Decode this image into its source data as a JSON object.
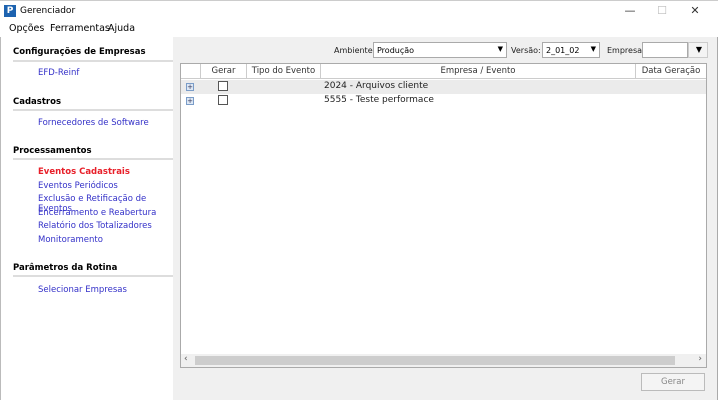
{
  "window": {
    "title": "Gerenciador",
    "minimize": "—",
    "maximize": "☐",
    "close": "✕"
  },
  "menu": [
    "Opções",
    "Ferramentas",
    "Ajuda"
  ],
  "sidebar": {
    "sections": [
      {
        "title": "Configurações de Empresas",
        "items": [
          "EFD-Reinf"
        ]
      },
      {
        "title": "Cadastros",
        "items": [
          "Fornecedores de Software"
        ]
      },
      {
        "title": "Processamentos",
        "items": [
          "Eventos Cadastrais",
          "Eventos Periódicos",
          "Exclusão e Retificação de Eventos",
          "Encerramento e Reabertura",
          "Relatório dos Totalizadores",
          "Monitoramento"
        ]
      },
      {
        "title": "Parâmetros da Rotina",
        "items": [
          "Selecionar Empresas"
        ]
      }
    ],
    "active": "Eventos Cadastrais"
  },
  "toolbar": {
    "ambiente_label": "Ambiente:",
    "ambiente_value": "Produção",
    "versao_label": "Versão:",
    "versao_value": "2_01_02",
    "empresa_label": "Empresa:",
    "empresa_value": ""
  },
  "grid": {
    "columns": [
      "Gerar",
      "Tipo do Evento",
      "Empresa / Evento",
      "Data Geração"
    ],
    "rows": [
      {
        "gerar": false,
        "tipo": "",
        "empresa": "2024 - Arquivos cliente",
        "data": ""
      },
      {
        "gerar": false,
        "tipo": "",
        "empresa": "5555 - Teste performace",
        "data": ""
      }
    ]
  },
  "footer": {
    "gerar_label": "Gerar"
  }
}
